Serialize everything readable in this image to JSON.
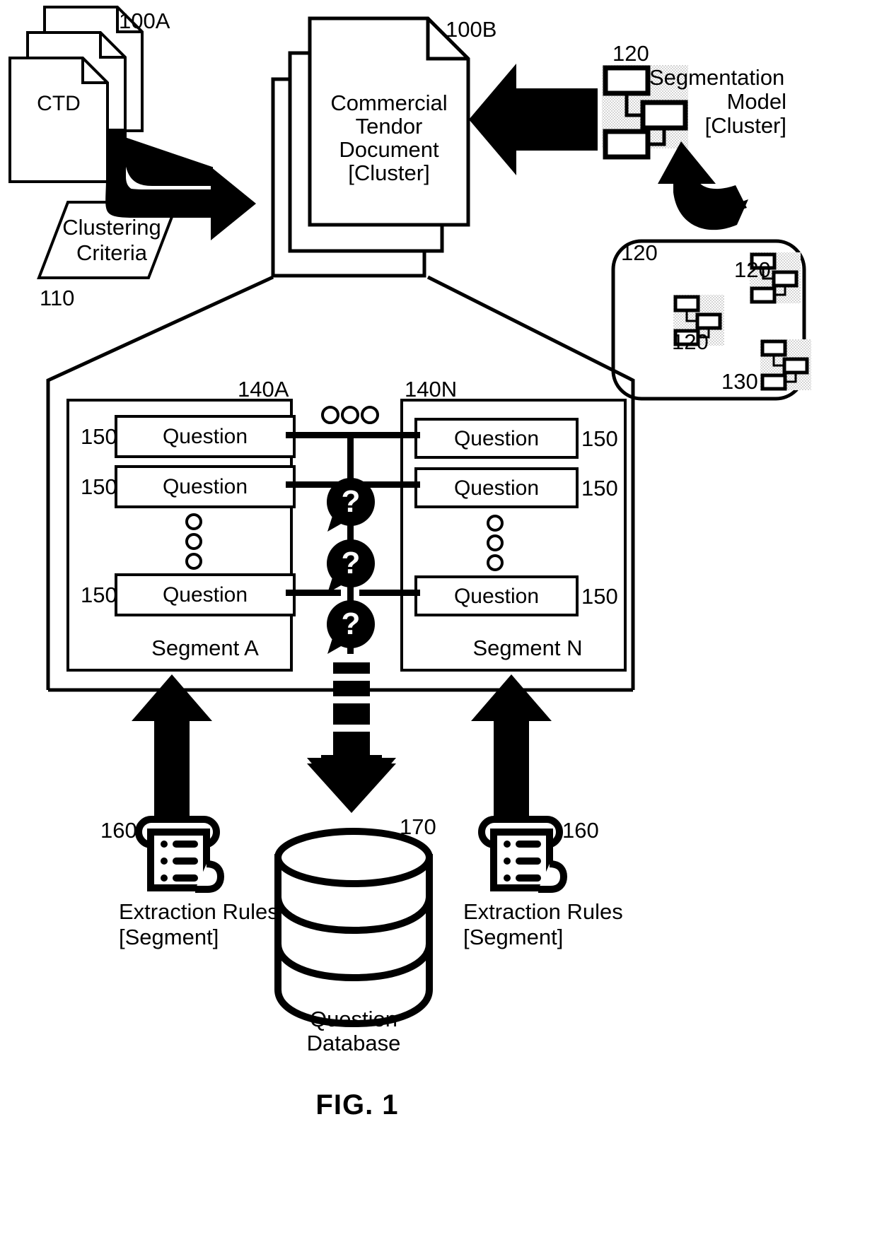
{
  "figure": {
    "caption": "FIG. 1",
    "title_implicit": "Commercial Tender Document Segmentation and Question Extraction"
  },
  "nodes": {
    "ctd_stack": {
      "ref": "100A",
      "label": "CTD",
      "icon": "document-stack-icon"
    },
    "clustering_criteria": {
      "ref": "110",
      "label_line1": "Clustering",
      "label_line2": "Criteria",
      "icon": "parallelogram-data-icon"
    },
    "ctd_cluster_stack": {
      "ref": "100B",
      "label_line1": "Commercial",
      "label_line2": "Tendor",
      "label_line3": "Document",
      "label_line4": "[Cluster]",
      "icon": "document-stack-icon"
    },
    "segmentation_model": {
      "ref": "120",
      "label_line1": "Segmentation",
      "label_line2": "Model",
      "label_line3": "[Cluster]",
      "icon": "hierarchy-model-icon"
    },
    "model_pool": {
      "ref": "130",
      "icon": "rounded-container-icon",
      "members": [
        {
          "ref": "120",
          "icon": "hierarchy-model-icon"
        },
        {
          "ref": "120",
          "icon": "hierarchy-model-icon"
        },
        {
          "ref": "120",
          "icon": "hierarchy-model-icon"
        }
      ]
    },
    "segment_a": {
      "ref": "140A",
      "title": "Segment A",
      "questions": [
        {
          "ref": "150",
          "label": "Question"
        },
        {
          "ref": "150",
          "label": "Question"
        },
        {
          "ref": "150",
          "label": "Question"
        }
      ],
      "vertical_ellipsis": "circle-ellipsis-icon"
    },
    "segment_n": {
      "ref": "140N",
      "title": "Segment N",
      "questions": [
        {
          "ref": "150",
          "label": "Question"
        },
        {
          "ref": "150",
          "label": "Question"
        },
        {
          "ref": "150",
          "label": "Question"
        }
      ],
      "vertical_ellipsis": "circle-ellipsis-icon"
    },
    "horizontal_ellipsis": "circle-ellipsis-horizontal-icon",
    "question_bubbles": [
      {
        "icon": "question-bubble-icon",
        "glyph": "?"
      },
      {
        "icon": "question-bubble-icon",
        "glyph": "?"
      },
      {
        "icon": "question-bubble-icon",
        "glyph": "?"
      }
    ],
    "extraction_rules_left": {
      "ref": "160",
      "label_line1": "Extraction Rules",
      "label_line2": "[Segment]",
      "icon": "scroll-rules-icon"
    },
    "extraction_rules_right": {
      "ref": "160",
      "label_line1": "Extraction Rules",
      "label_line2": "[Segment]",
      "icon": "scroll-rules-icon"
    },
    "question_database": {
      "ref": "170",
      "label_line1": "Question",
      "label_line2": "Database",
      "icon": "database-cylinder-icon"
    }
  },
  "arrows": {
    "ctd_to_cluster": "curved-right-arrow",
    "model_to_cluster": "left-arrow",
    "pool_to_model": "curved-up-arrow",
    "rules_left_up": "up-arrow",
    "rules_right_up": "up-arrow",
    "questions_to_db": "down-arrow-dashed"
  },
  "colors": {
    "stroke": "#000000",
    "fill": "#ffffff",
    "shade": "#d9d9d9"
  }
}
